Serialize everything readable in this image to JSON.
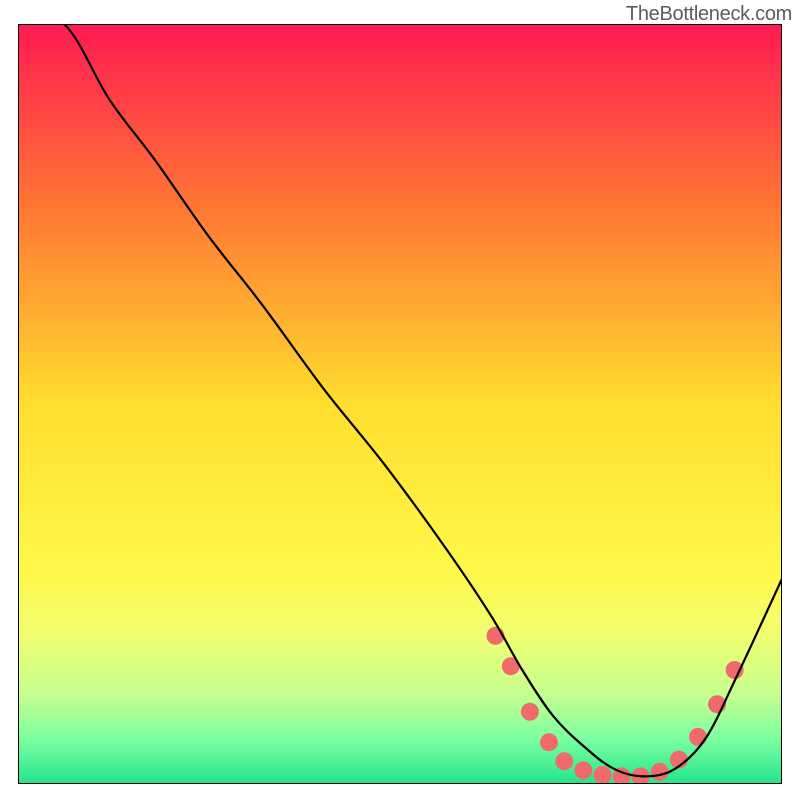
{
  "watermark": "TheBottleneck.com",
  "chart_data": {
    "type": "line",
    "title": "",
    "xlabel": "",
    "ylabel": "",
    "xlim": [
      0,
      100
    ],
    "ylim": [
      0,
      100
    ],
    "grid": false,
    "legend": false,
    "gradient_stops": [
      {
        "offset": 0,
        "color": "#ff1a52"
      },
      {
        "offset": 25,
        "color": "#ff7a33"
      },
      {
        "offset": 50,
        "color": "#ffde2e"
      },
      {
        "offset": 72,
        "color": "#fff84a"
      },
      {
        "offset": 80,
        "color": "#f2ff70"
      },
      {
        "offset": 88,
        "color": "#c7ff8e"
      },
      {
        "offset": 94,
        "color": "#7dffa0"
      },
      {
        "offset": 100,
        "color": "#24e58c"
      }
    ],
    "curve": {
      "name": "bottleneck-curve",
      "x": [
        0,
        6,
        12,
        18,
        25,
        32,
        40,
        48,
        56,
        62,
        66,
        70,
        74,
        78,
        82,
        86,
        90,
        94,
        100
      ],
      "y": [
        100,
        100,
        90,
        82,
        72,
        63,
        52,
        42,
        31,
        22,
        15,
        9,
        5,
        2,
        1,
        2,
        6,
        14,
        27
      ]
    },
    "dots": {
      "name": "bottleneck-zone",
      "color": "#ef6a6a",
      "points": [
        {
          "x": 62.5,
          "y": 19.5
        },
        {
          "x": 64.5,
          "y": 15.5
        },
        {
          "x": 67.0,
          "y": 9.5
        },
        {
          "x": 69.5,
          "y": 5.5
        },
        {
          "x": 71.5,
          "y": 3.0
        },
        {
          "x": 74.0,
          "y": 1.8
        },
        {
          "x": 76.5,
          "y": 1.2
        },
        {
          "x": 79.0,
          "y": 1.0
        },
        {
          "x": 81.5,
          "y": 1.0
        },
        {
          "x": 84.0,
          "y": 1.6
        },
        {
          "x": 86.5,
          "y": 3.2
        },
        {
          "x": 89.0,
          "y": 6.2
        },
        {
          "x": 91.5,
          "y": 10.5
        },
        {
          "x": 93.8,
          "y": 15.0
        }
      ]
    }
  }
}
